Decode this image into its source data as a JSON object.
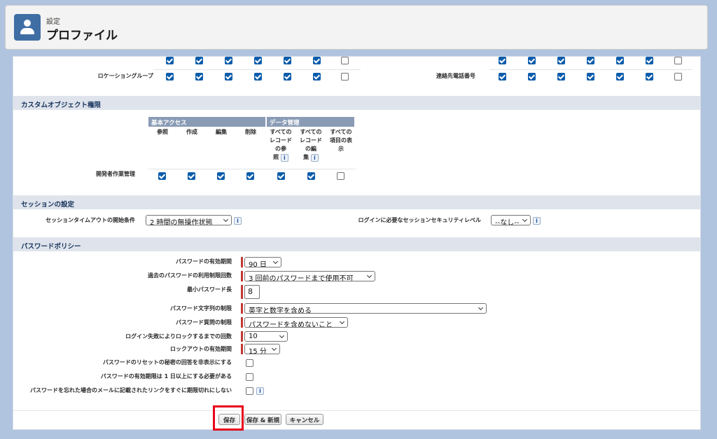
{
  "header": {
    "breadcrumb": "設定",
    "title": "プロファイル",
    "icon": "user-icon"
  },
  "top_rows": {
    "left_label": "ロケーショングループ",
    "right_label": "連絡先電話番号",
    "first_row_left": [
      true,
      true,
      true,
      true,
      true,
      true,
      false
    ],
    "left_values": [
      true,
      true,
      true,
      true,
      true,
      true,
      false
    ],
    "first_row_right": [
      true,
      true,
      true,
      true,
      true,
      true,
      false
    ],
    "right_values": [
      true,
      true,
      true,
      true,
      true,
      true,
      false
    ]
  },
  "custom_object": {
    "title": "カスタムオブジェクト権限",
    "group_basic": "基本アクセス",
    "group_data": "データ管理",
    "col_read": "参照",
    "col_create": "作成",
    "col_edit": "編集",
    "col_delete": "削除",
    "col_view_all_a": "すべての",
    "col_view_all_b": "レコード",
    "col_view_all_c": "の参",
    "col_view_all_d": "照",
    "col_modify_all_a": "すべての",
    "col_modify_all_b": "レコード",
    "col_modify_all_c": "の編",
    "col_modify_all_d": "集",
    "col_view_fields_a": "すべての",
    "col_view_fields_b": "項目の表",
    "col_view_fields_c": "示",
    "row_label": "開発者作業管理",
    "row_values": [
      true,
      true,
      true,
      true,
      true,
      true,
      false
    ]
  },
  "session": {
    "title": "セッションの設定",
    "timeout_label": "セッションタイムアウトの開始条件",
    "timeout_value": "2 時間の無操作状態",
    "security_label": "ログインに必要なセッションセキュリティレベル",
    "security_value": "--なし--"
  },
  "password": {
    "title": "パスワードポリシー",
    "expires_label": "パスワードの有効期間",
    "expires_value": "90 日",
    "history_label": "過去のパスワードの利用制限回数",
    "history_value": "3 回前のパスワードまで使用不可",
    "min_length_label": "最小パスワード長",
    "min_length_value": "8",
    "complexity_label": "パスワード文字列の制限",
    "complexity_value": "英字と数字を含める",
    "question_label": "パスワード質問の制限",
    "question_value": "パスワードを含めないこと",
    "lockout_attempts_label": "ログイン失敗によりロックするまでの回数",
    "lockout_attempts_value": "10",
    "lockout_period_label": "ロックアウトの有効期間",
    "lockout_period_value": "15 分",
    "hide_answer_label": "パスワードのリセットの秘密の回答を非表示にする",
    "min_lifetime_label": "パスワードの有効期限は 1 日以上にする必要がある",
    "link_expire_label": "パスワードを忘れた場合のメールに記載されたリンクをすぐに期限切れにしない"
  },
  "buttons": {
    "save": "保存",
    "save_new": "保存 & 新規",
    "cancel": "キャンセル"
  },
  "colors": {
    "accent": "#0b5cab",
    "highlight": "#e8001b",
    "required": "#c23934"
  }
}
